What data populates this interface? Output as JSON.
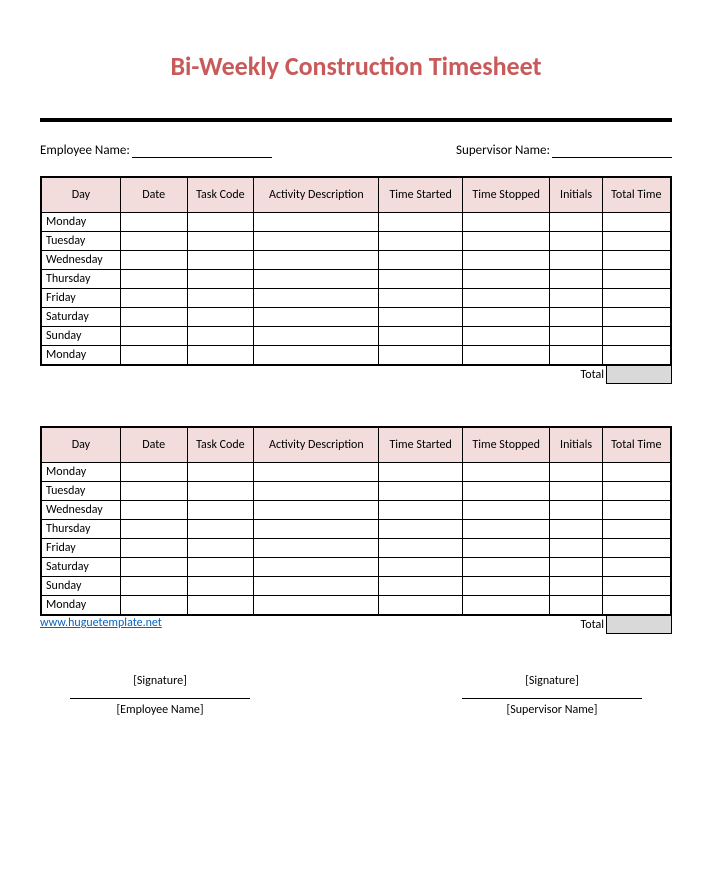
{
  "title": "Bi-Weekly Construction Timesheet",
  "fields": {
    "employee_label": "Employee Name:",
    "supervisor_label": "Supervisor Name:"
  },
  "headers": {
    "day": "Day",
    "date": "Date",
    "task": "Task Code",
    "activity": "Activity Description",
    "start": "Time Started",
    "stop": "Time Stopped",
    "initials": "Initials",
    "total": "Total Time"
  },
  "week1": {
    "days": [
      "Monday",
      "Tuesday",
      "Wednesday",
      "Thursday",
      "Friday",
      "Saturday",
      "Sunday",
      "Monday"
    ],
    "total_label": "Total"
  },
  "week2": {
    "days": [
      "Monday",
      "Tuesday",
      "Wednesday",
      "Thursday",
      "Friday",
      "Saturday",
      "Sunday",
      "Monday"
    ],
    "total_label": "Total"
  },
  "link": "www.huguetemplate.net",
  "signatures": {
    "sig_label": "[Signature]",
    "emp_name": "[Employee Name]",
    "sup_name": "[Supervisor Name]"
  }
}
